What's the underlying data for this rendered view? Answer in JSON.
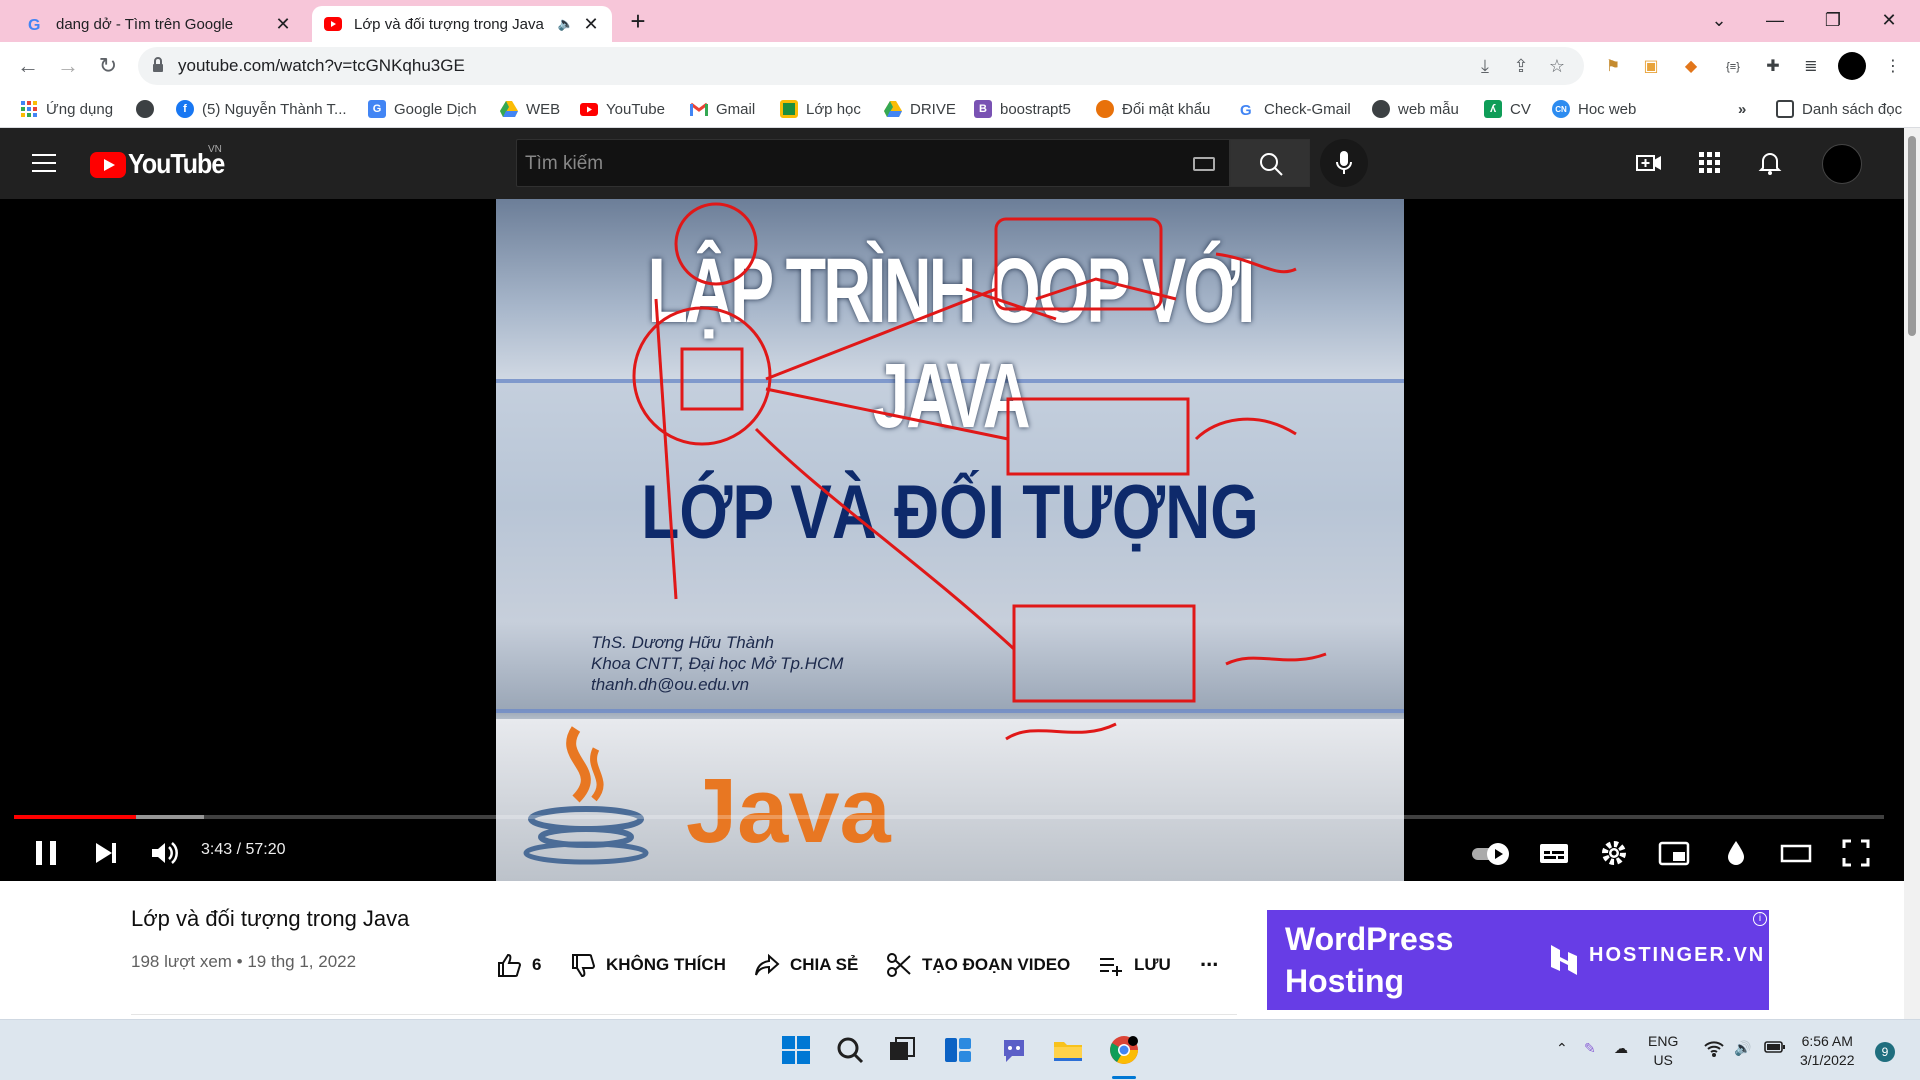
{
  "browser": {
    "tabs": [
      {
        "title": "dang dở - Tìm trên Google",
        "icon": "google-icon",
        "active": false
      },
      {
        "title": "Lớp và đối tượng trong Java",
        "icon": "youtube-icon",
        "active": true,
        "audio": "speaker-icon"
      }
    ],
    "url": "youtube.com/watch?v=tcGNKqhu3GE",
    "bookmarks": [
      {
        "label": "Ứng dụng",
        "icon": "apps-grid-icon"
      },
      {
        "label": "",
        "icon": "globe-icon"
      },
      {
        "label": "(5) Nguyễn Thành T...",
        "icon": "facebook-icon"
      },
      {
        "label": "Google Dịch",
        "icon": "translate-icon"
      },
      {
        "label": "WEB",
        "icon": "drive-icon"
      },
      {
        "label": "YouTube",
        "icon": "youtube-icon"
      },
      {
        "label": "Gmail",
        "icon": "gmail-icon"
      },
      {
        "label": "Lớp học",
        "icon": "classroom-icon"
      },
      {
        "label": "DRIVE",
        "icon": "drive-icon"
      },
      {
        "label": "boostrapt5",
        "icon": "bootstrap-icon"
      },
      {
        "label": "Đổi mật khẩu",
        "icon": "pumpkin-icon"
      },
      {
        "label": "Check-Gmail",
        "icon": "google-icon"
      },
      {
        "label": "web mẫu",
        "icon": "globe-icon"
      },
      {
        "label": "CV",
        "icon": "cv-icon"
      },
      {
        "label": "Hoc web",
        "icon": "cn-icon"
      }
    ],
    "more_bookmarks": "»",
    "reading_list": "Danh sách đọc"
  },
  "youtube": {
    "logo_text": "YouTube",
    "country_code": "VN",
    "search_placeholder": "Tìm kiếm",
    "player": {
      "time_current": "3:43",
      "time_total": "57:20",
      "time_display": "3:43 / 57:20",
      "progress_fraction": 0.065,
      "slide": {
        "title1": "LẬP TRÌNH OOP VỚI JAVA",
        "title2": "LỚP VÀ ĐỐI TƯỢNG",
        "author_line1": "ThS. Dương Hữu Thành",
        "author_line2": "Khoa CNTT, Đại học Mở Tp.HCM",
        "author_line3": "thanh.dh@ou.edu.vn",
        "java": "Java"
      }
    },
    "video": {
      "title": "Lớp và đối tượng trong Java",
      "meta": "198 lượt xem • 19 thg 1, 2022",
      "likes": "6",
      "dislike_label": "KHÔNG THÍCH",
      "share_label": "CHIA SẺ",
      "clip_label": "TẠO ĐOẠN VIDEO",
      "save_label": "LƯU",
      "more_label": "..."
    },
    "ad": {
      "headline_line1": "WordPress",
      "headline_line2": "Hosting",
      "brand": "HOSTINGER.VN",
      "info": "i"
    }
  },
  "taskbar": {
    "lang_line1": "ENG",
    "lang_line2": "US",
    "time": "6:56 AM",
    "date": "3/1/2022",
    "notifications": "9"
  }
}
